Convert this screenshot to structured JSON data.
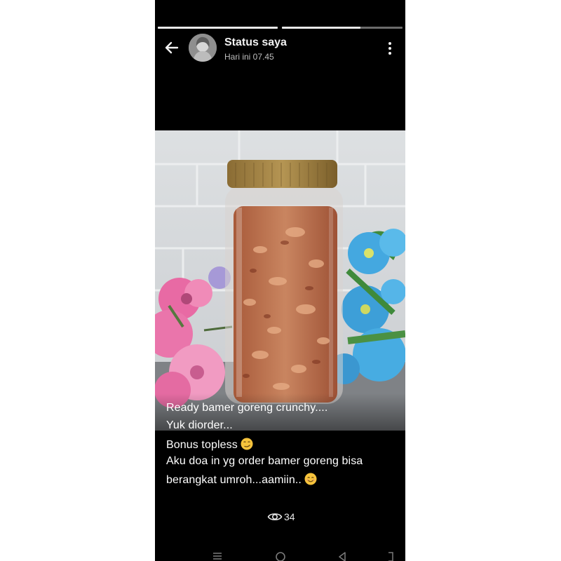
{
  "header": {
    "title": "Status saya",
    "subtitle": "Hari ini 07.45"
  },
  "progress": [
    {
      "fraction": 1.0
    },
    {
      "fraction": 0.65
    }
  ],
  "caption": {
    "lines": [
      "Ready bamer goreng crunchy....",
      "Yuk diorder...",
      "Bonus topless",
      "Aku doa in yg order bamer goreng bisa",
      "berangkat umroh...aamiin.."
    ]
  },
  "views": {
    "count": "34"
  },
  "icons": {
    "back": "arrow-left-icon",
    "menu": "more-vert-icon",
    "views": "eye-icon",
    "nav_recent": "menu-lines-icon",
    "nav_home": "circle-home-icon",
    "nav_back": "triangle-back-icon",
    "nav_extra": "bracket-icon"
  },
  "colors": {
    "background": "#000000",
    "text": "#ffffff",
    "subtext": "#bdbdbd",
    "progress_fill": "#e8e8e8",
    "progress_track": "#6b6b6b"
  }
}
